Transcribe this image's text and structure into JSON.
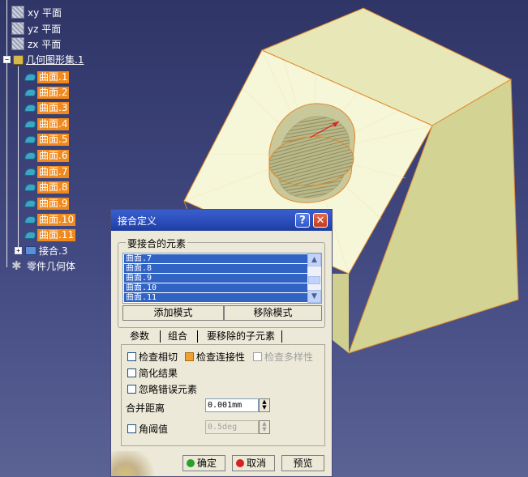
{
  "tree": {
    "planes": [
      "xy 平面",
      "yz 平面",
      "zx 平面"
    ],
    "geo_set": "几何图形集.1",
    "surfaces": [
      "曲面.1",
      "曲面.2",
      "曲面.3",
      "曲面.4",
      "曲面.5",
      "曲面.6",
      "曲面.7",
      "曲面.8",
      "曲面.9",
      "曲面.10",
      "曲面.11"
    ],
    "join": "接合.3",
    "part_body": "零件几何体"
  },
  "dialog": {
    "title": "接合定义",
    "help": "?",
    "close": "✕",
    "elements_group": "要接合的元素",
    "elements": [
      "曲面.7",
      "曲面.8",
      "曲面.9",
      "曲面.10",
      "曲面.11"
    ],
    "add_mode": "添加模式",
    "remove_mode": "移除模式",
    "tabs": [
      "参数",
      "组合",
      "要移除的子元素"
    ],
    "check_tangency": "检查相切",
    "check_connexity": "检查连接性",
    "check_manifold": "检查多样性",
    "simplify": "简化结果",
    "ignore_errors": "忽略错误元素",
    "merge_distance_label": "合并距离",
    "merge_distance": "0.001mm",
    "angle_label": "角阈值",
    "angle_value": "0.5deg",
    "ok": "确定",
    "cancel": "取消",
    "preview": "预览"
  },
  "colors": {
    "highlight": "#f08a1e",
    "selection": "#3163c5",
    "titlebar": "#2a4cb8",
    "solid_face": "#d8d89a"
  }
}
